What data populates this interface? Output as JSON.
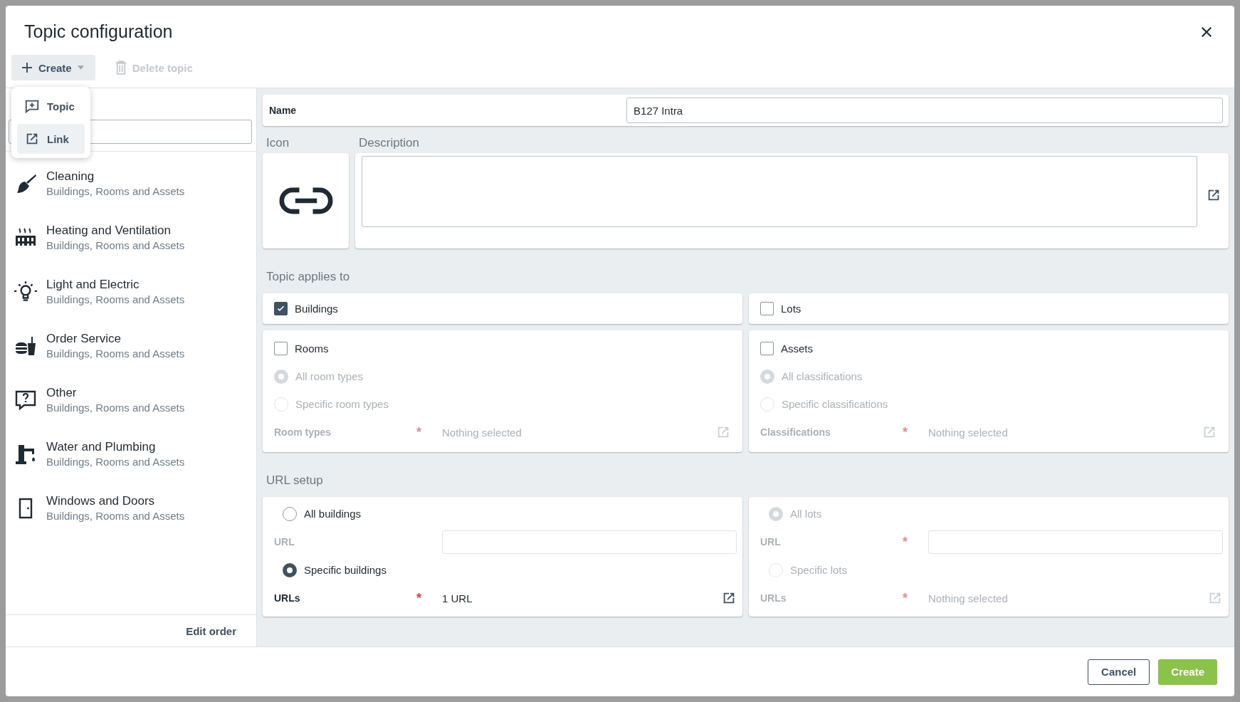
{
  "dialog": {
    "title": "Topic configuration"
  },
  "toolbar": {
    "create_button": "Create",
    "delete_button": {
      "label": "Delete topic",
      "disabled": true
    }
  },
  "create_menu": [
    {
      "label": "Topic",
      "selected": false
    },
    {
      "label": "Link",
      "selected": true
    }
  ],
  "topics": [
    {
      "name": "Cleaning",
      "subtitle": "Buildings, Rooms and Assets"
    },
    {
      "name": "Heating and Ventilation",
      "subtitle": "Buildings, Rooms and Assets"
    },
    {
      "name": "Light and Electric",
      "subtitle": "Buildings, Rooms and Assets"
    },
    {
      "name": "Order Service",
      "subtitle": "Buildings, Rooms and Assets"
    },
    {
      "name": "Other",
      "subtitle": "Buildings, Rooms and Assets"
    },
    {
      "name": "Water and Plumbing",
      "subtitle": "Buildings, Rooms and Assets"
    },
    {
      "name": "Windows and Doors",
      "subtitle": "Buildings, Rooms and Assets"
    }
  ],
  "edit_order": "Edit order",
  "form": {
    "name_label": "Name",
    "name_value": "B127 Intra",
    "icon_label": "Icon",
    "description_label": "Description",
    "applies_to_label": "Topic applies to",
    "applies_to": [
      {
        "label": "Buildings",
        "checked": true
      },
      {
        "label": "Lots",
        "checked": false
      }
    ],
    "applies_panels": [
      {
        "rows": [
          {
            "kind": "checkbox",
            "label": "Rooms",
            "checked": false,
            "disabled": false
          },
          {
            "kind": "radio",
            "label": "All room types",
            "selected": true,
            "disabled": true
          },
          {
            "kind": "radio",
            "label": "Specific room types",
            "selected": false,
            "disabled": true
          },
          {
            "kind": "picker",
            "label": "Room types",
            "required_mark": "*",
            "value": "Nothing selected",
            "disabled": true
          }
        ]
      },
      {
        "rows": [
          {
            "kind": "checkbox",
            "label": "Assets",
            "checked": false,
            "disabled": false
          },
          {
            "kind": "radio",
            "label": "All classifications",
            "selected": true,
            "disabled": true
          },
          {
            "kind": "radio",
            "label": "Specific classifications",
            "selected": false,
            "disabled": true
          },
          {
            "kind": "picker",
            "label": "Classifications",
            "required_mark": "*",
            "value": "Nothing selected",
            "disabled": true
          }
        ]
      }
    ],
    "url_setup_label": "URL setup",
    "url_panels": [
      {
        "rows": [
          {
            "kind": "radio",
            "label": "All buildings",
            "selected": false,
            "disabled": false
          },
          {
            "kind": "field",
            "label": "URL",
            "disabled": true
          },
          {
            "kind": "radio",
            "label": "Specific buildings",
            "selected": true,
            "disabled": false
          },
          {
            "kind": "picker",
            "label": "URLs",
            "required_mark": "*",
            "value": "1 URL",
            "disabled": false
          }
        ]
      },
      {
        "rows": [
          {
            "kind": "radio",
            "label": "All lots",
            "selected": true,
            "disabled": true
          },
          {
            "kind": "field",
            "label": "URL",
            "required_mark": "*",
            "disabled": true
          },
          {
            "kind": "radio",
            "label": "Specific lots",
            "selected": false,
            "disabled": true
          },
          {
            "kind": "picker",
            "label": "URLs",
            "required_mark": "*",
            "value": "Nothing selected",
            "disabled": true
          }
        ]
      }
    ]
  },
  "footer": {
    "cancel": "Cancel",
    "create": "Create"
  }
}
